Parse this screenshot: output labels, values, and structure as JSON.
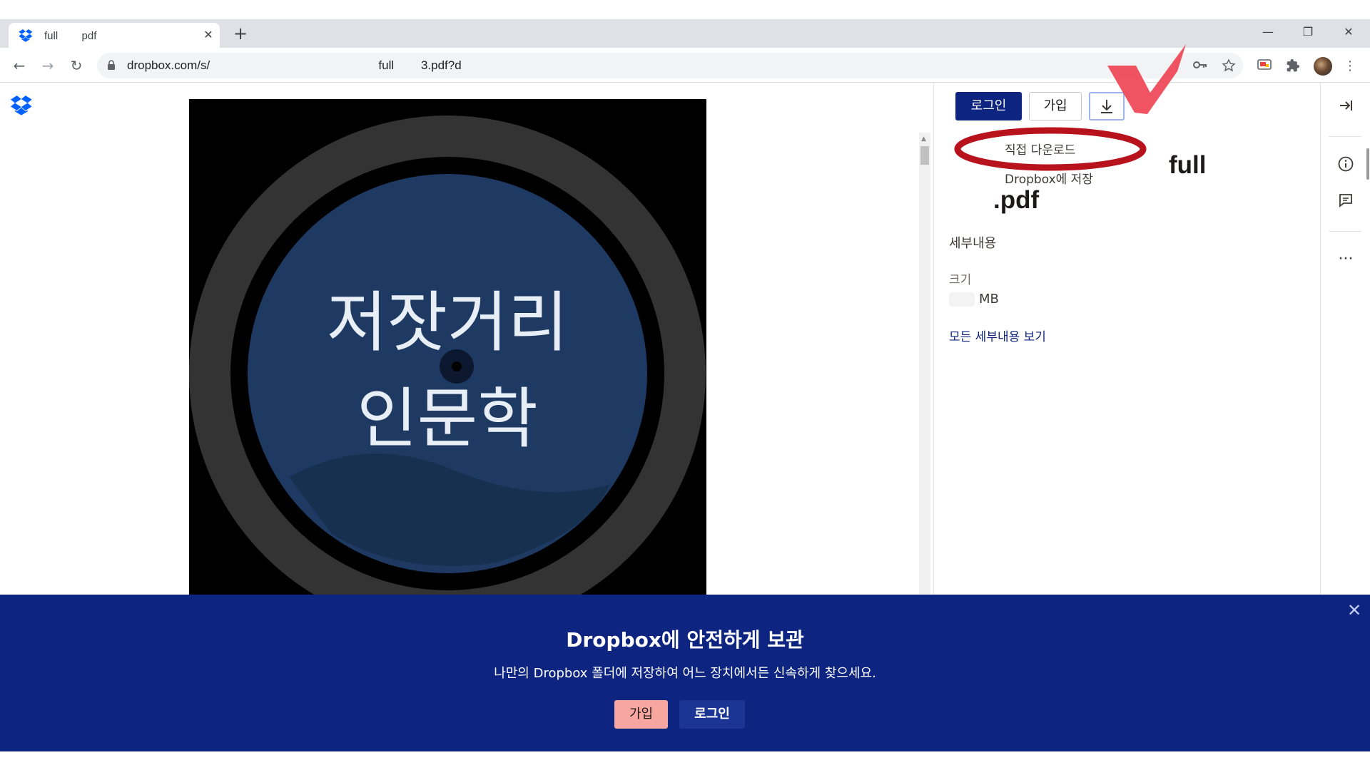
{
  "browser": {
    "tab_title": "full        pdf",
    "tab_close": "✕",
    "new_tab": "+",
    "window_controls": {
      "minimize": "—",
      "maximize": "❐",
      "close": "✕"
    },
    "nav": {
      "back": "←",
      "forward": "→",
      "reload": "↻"
    },
    "url_prefix": "dropbox.com/s/",
    "url_middle": "full",
    "url_suffix": "3.pdf?d"
  },
  "panel": {
    "login_label": "로그인",
    "signup_label": "가입",
    "download_menu": {
      "direct_download": "직접 다운로드",
      "save_to_dropbox": "Dropbox에 저장"
    },
    "filename_top": "full",
    "filename_bottom": ".pdf",
    "details_heading": "세부내용",
    "size_label": "크기",
    "size_unit": "MB",
    "all_details_link": "모든 세부내용 보기"
  },
  "preview": {
    "line1": "저잣거리",
    "line2": "인문학"
  },
  "banner": {
    "title": "Dropbox에 안전하게 보관",
    "subtitle": "나만의 Dropbox 폴더에 저장하여 어느 장치에서든 신속하게 찾으세요.",
    "signup_label": "가입",
    "login_label": "로그인",
    "close": "✕"
  },
  "colors": {
    "dropbox_blue": "#0061fe",
    "navy": "#0d2481",
    "annotation_red": "#b8121d",
    "check_red": "#ee3b4c",
    "signup_pink": "#f7a6a0"
  }
}
